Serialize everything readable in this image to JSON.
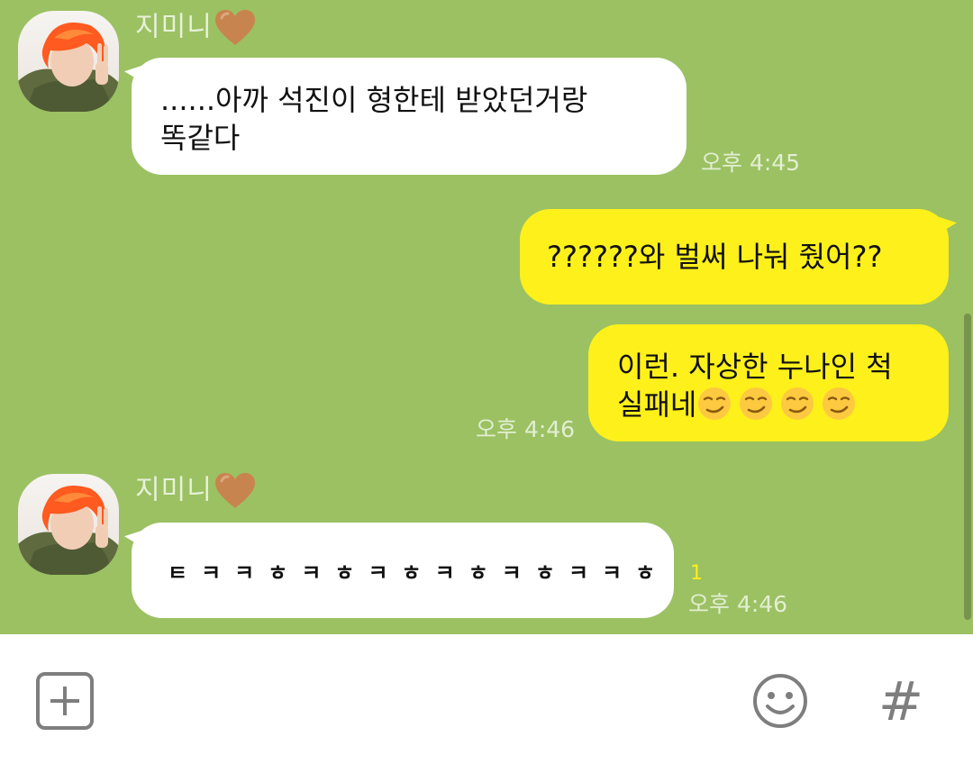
{
  "chat": {
    "messages": [
      {
        "sender": "지미니",
        "direction": "incoming",
        "lines": [
          "......아까 석진이 형한테 받았던거랑",
          "똑같다"
        ],
        "time": "오후 4:45"
      },
      {
        "direction": "outgoing",
        "lines": [
          "??????와 벌써 나눠 줬어??"
        ]
      },
      {
        "direction": "outgoing",
        "lines": [
          "이런. 자상한 누나인 척",
          "실패네"
        ],
        "emoji": "smirking-face-emoji",
        "emoji_count": 4,
        "time": "오후 4:46"
      },
      {
        "sender": "지미니",
        "direction": "incoming",
        "lines": [
          "ㅌㅋㅋㅎㅋㅎㅋㅎㅋㅎㅋㅎㅋㅋㅎ"
        ],
        "unread": "1",
        "time": "오후 4:46"
      }
    ]
  },
  "input_bar": {
    "plus_icon": "plus-square-icon",
    "emoticon_icon": "smiley-icon",
    "hash_label": "#"
  },
  "colors": {
    "chat_background": "#9bc163",
    "outgoing_bubble": "#fef01b",
    "incoming_bubble": "#ffffff",
    "heart": "#c8844f"
  }
}
